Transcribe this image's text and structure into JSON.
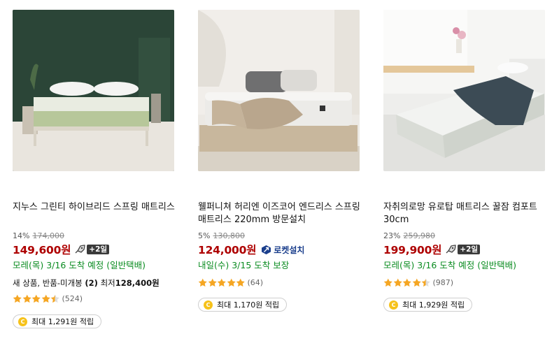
{
  "colors": {
    "price_red": "#ae0000",
    "delivery_green": "#0b8c21",
    "star_gold": "#f5a623",
    "coin_yellow": "#f6c21b",
    "install_blue": "#1a3e8c"
  },
  "products": [
    {
      "title": "지누스 그린티 하이브리드 스프링 매트리스",
      "discount": "14%",
      "original_price": "174,000",
      "price": "149,600원",
      "rocket_icon": "rocket-icon",
      "plus_badge": "+2일",
      "delivery": "모레(목) 3/16 도착 예정 (일반택배)",
      "extra_prefix": "새 상품, 반품-미개봉 ",
      "extra_count": "(2)",
      "extra_mid": " 최저",
      "extra_price": "128,400원",
      "rating_stars": 4.5,
      "review_count": "(524)",
      "coin_symbol": "C",
      "point_text": "최대 1,291원 적립"
    },
    {
      "title": "웰퍼니쳐 허리엔 이즈코어 엔드리스 스프링 매트리스 220mm 방문설치",
      "discount": "5%",
      "original_price": "130,800",
      "price": "124,000원",
      "install_icon": "rocket-install-icon",
      "install_label": "로켓설치",
      "delivery": "내일(수) 3/15 도착 보장",
      "rating_stars": 5,
      "review_count": "(64)",
      "coin_symbol": "C",
      "point_text": "최대 1,170원 적립"
    },
    {
      "title": "자취의로망 유로탑 매트리스 꿀잠 컴포트 30cm",
      "discount": "23%",
      "original_price": "259,980",
      "price": "199,900원",
      "rocket_icon": "rocket-icon",
      "plus_badge": "+2일",
      "delivery": "모레(목) 3/16 도착 예정 (일반택배)",
      "rating_stars": 4.5,
      "review_count": "(987)",
      "coin_symbol": "C",
      "point_text": "최대 1,929원 적립"
    }
  ]
}
